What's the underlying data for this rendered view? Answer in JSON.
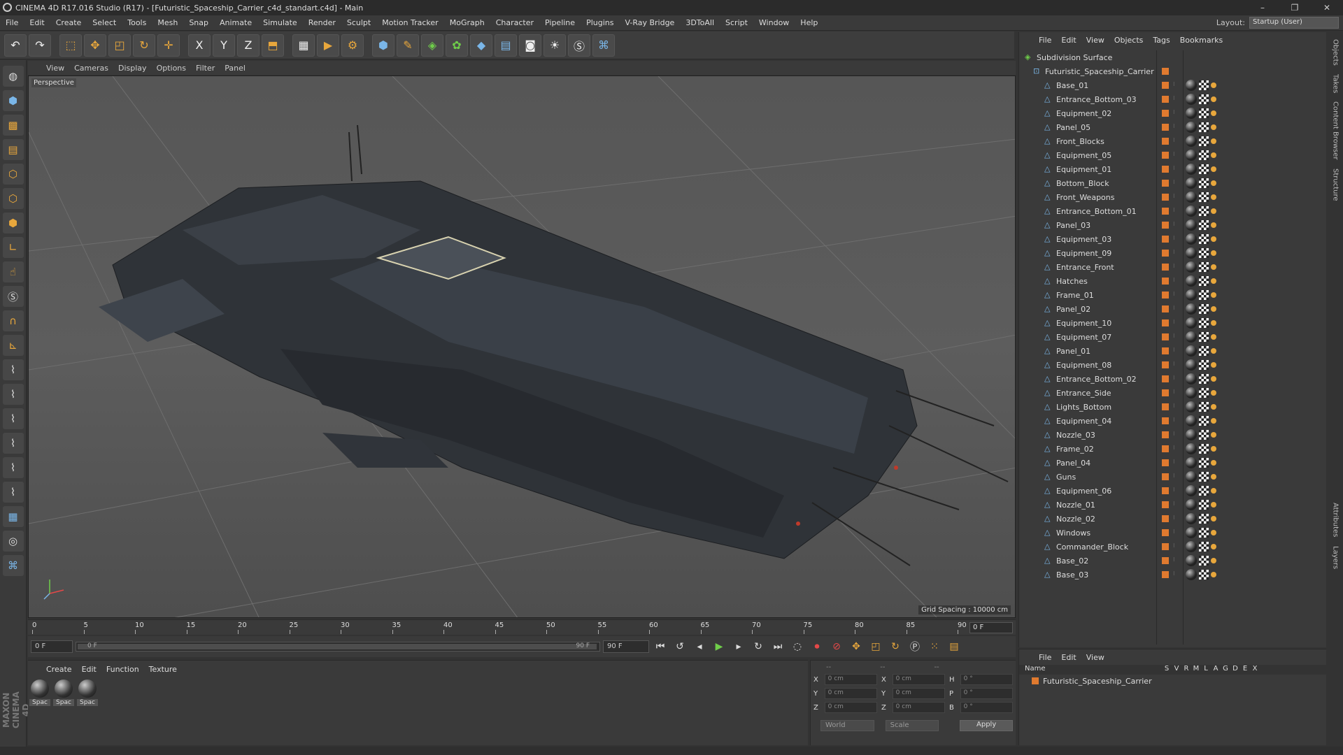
{
  "window": {
    "title": "CINEMA 4D R17.016 Studio (R17) - [Futuristic_Spaceship_Carrier_c4d_standart.c4d] - Main",
    "buttons": [
      "–",
      "❐",
      "✕"
    ]
  },
  "menubar": {
    "items": [
      "File",
      "Edit",
      "Create",
      "Select",
      "Tools",
      "Mesh",
      "Snap",
      "Animate",
      "Simulate",
      "Render",
      "Sculpt",
      "Motion Tracker",
      "MoGraph",
      "Character",
      "Pipeline",
      "Plugins",
      "V-Ray Bridge",
      "3DToAll",
      "Script",
      "Window",
      "Help"
    ],
    "layout_label": "Layout:",
    "layout_value": "Startup (User)"
  },
  "toolbar": {
    "icons": [
      "undo-icon",
      "redo-icon",
      "live-selection-icon",
      "move-icon",
      "scale-icon",
      "rotate-icon",
      "transform-icon",
      "x-axis-icon",
      "y-axis-icon",
      "z-axis-icon",
      "coordinate-system-icon",
      "render-view-icon",
      "render-picture-viewer-icon",
      "edit-render-settings-icon",
      "cube-icon",
      "spline-pen-icon",
      "subdivision-icon",
      "cloner-icon",
      "deformer-icon",
      "floor-icon",
      "camera-icon",
      "light-icon",
      "vray-icon",
      "python-icon"
    ],
    "axis_labels": [
      "X",
      "Y",
      "Z"
    ]
  },
  "viewport": {
    "menu": [
      "View",
      "Cameras",
      "Display",
      "Options",
      "Filter",
      "Panel"
    ],
    "label": "Perspective",
    "grid_spacing": "Grid Spacing : 10000 cm"
  },
  "timeline": {
    "ticks": [
      "0",
      "5",
      "10",
      "15",
      "20",
      "25",
      "30",
      "35",
      "40",
      "45",
      "50",
      "55",
      "60",
      "65",
      "70",
      "75",
      "80",
      "85",
      "90"
    ],
    "current_frame": "0 F",
    "start_field": "0 F",
    "range_start": "0 F",
    "range_end": "90 F",
    "end_field": "90 F"
  },
  "material_panel": {
    "menu": [
      "Create",
      "Edit",
      "Function",
      "Texture"
    ],
    "materials": [
      "Spac",
      "Spac",
      "Spac"
    ]
  },
  "coordinates": {
    "header": [
      "--",
      "--",
      "--"
    ],
    "rows": [
      {
        "a": "X",
        "av": "0 cm",
        "b": "X",
        "bv": "0 cm",
        "c": "H",
        "cv": "0 °"
      },
      {
        "a": "Y",
        "av": "0 cm",
        "b": "Y",
        "bv": "0 cm",
        "c": "P",
        "cv": "0 °"
      },
      {
        "a": "Z",
        "av": "0 cm",
        "b": "Z",
        "bv": "0 cm",
        "c": "B",
        "cv": "0 °"
      }
    ],
    "mode1": "World",
    "mode2": "Scale",
    "apply": "Apply"
  },
  "object_manager": {
    "menu": [
      "File",
      "Edit",
      "View",
      "Objects",
      "Tags",
      "Bookmarks"
    ],
    "root": "Subdivision Surface",
    "parent": "Futuristic_Spaceship_Carrier",
    "children": [
      "Base_01",
      "Entrance_Bottom_03",
      "Equipment_02",
      "Panel_05",
      "Front_Blocks",
      "Equipment_05",
      "Equipment_01",
      "Bottom_Block",
      "Front_Weapons",
      "Entrance_Bottom_01",
      "Panel_03",
      "Equipment_03",
      "Equipment_09",
      "Entrance_Front",
      "Hatches",
      "Frame_01",
      "Panel_02",
      "Equipment_10",
      "Equipment_07",
      "Panel_01",
      "Equipment_08",
      "Entrance_Bottom_02",
      "Entrance_Side",
      "Lights_Bottom",
      "Equipment_04",
      "Nozzle_03",
      "Frame_02",
      "Panel_04",
      "Guns",
      "Equipment_06",
      "Nozzle_01",
      "Nozzle_02",
      "Windows",
      "Commander_Block",
      "Base_02",
      "Base_03"
    ]
  },
  "layer_manager": {
    "menu": [
      "File",
      "Edit",
      "View"
    ],
    "columns": [
      "Name",
      "S",
      "V",
      "R",
      "M",
      "L",
      "A",
      "G",
      "D",
      "E",
      "X"
    ],
    "layer": "Futuristic_Spaceship_Carrier"
  },
  "right_tabs": [
    "Objects",
    "Takes",
    "Content Browser",
    "Structure",
    "Attributes",
    "Layers"
  ],
  "maxon_logo": "MAXON CINEMA 4D",
  "colors": {
    "accent_orange": "#e07a2f",
    "axis_blue": "#7ab6e8",
    "play_green": "#6fce4a"
  }
}
